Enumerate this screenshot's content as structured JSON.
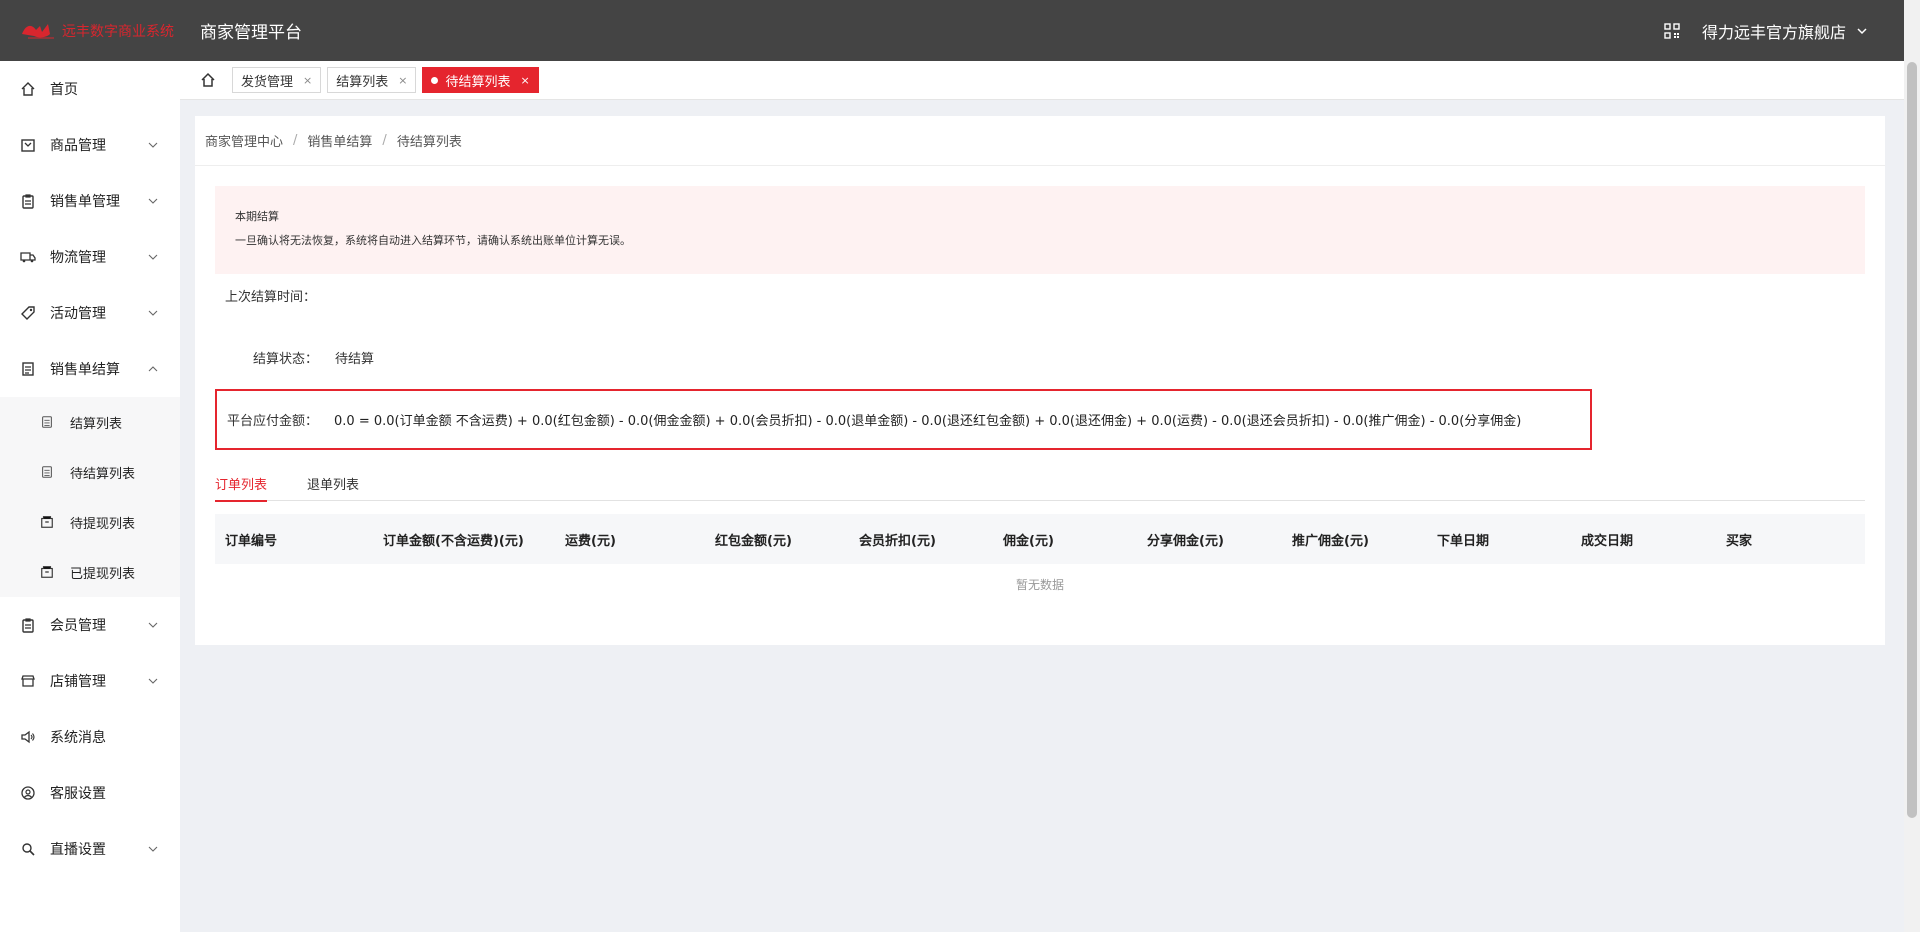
{
  "header": {
    "logo_text": "远丰数字商业系统",
    "app_title": "商家管理平台",
    "shop_name": "得力远丰官方旗舰店"
  },
  "sidebar": {
    "items": [
      {
        "label": "首页",
        "icon": "home-icon",
        "has_chevron": false
      },
      {
        "label": "商品管理",
        "icon": "goods-icon",
        "has_chevron": true
      },
      {
        "label": "销售单管理",
        "icon": "clipboard-icon",
        "has_chevron": true
      },
      {
        "label": "物流管理",
        "icon": "truck-icon",
        "has_chevron": true
      },
      {
        "label": "活动管理",
        "icon": "tag-icon",
        "has_chevron": true
      },
      {
        "label": "销售单结算",
        "icon": "document-icon",
        "has_chevron": true,
        "expanded": true
      }
    ],
    "submenu": [
      {
        "label": "结算列表",
        "icon": "list-icon"
      },
      {
        "label": "待结算列表",
        "icon": "list-icon"
      },
      {
        "label": "待提现列表",
        "icon": "wallet-icon"
      },
      {
        "label": "已提现列表",
        "icon": "wallet-icon"
      }
    ],
    "items_after": [
      {
        "label": "会员管理",
        "icon": "member-icon",
        "has_chevron": true
      },
      {
        "label": "店铺管理",
        "icon": "store-icon",
        "has_chevron": true
      },
      {
        "label": "系统消息",
        "icon": "speaker-icon",
        "has_chevron": false
      },
      {
        "label": "客服设置",
        "icon": "service-icon",
        "has_chevron": false
      },
      {
        "label": "直播设置",
        "icon": "live-icon",
        "has_chevron": true
      }
    ]
  },
  "tabs": [
    {
      "label": "发货管理",
      "active": false
    },
    {
      "label": "结算列表",
      "active": false
    },
    {
      "label": "待结算列表",
      "active": true
    }
  ],
  "breadcrumb": [
    "商家管理中心",
    "销售单结算",
    "待结算列表"
  ],
  "notice": {
    "title": "本期结算",
    "body": "一旦确认将无法恢复，系统将自动进入结算环节，请确认系统出账单位计算无误。"
  },
  "fields": {
    "last_time_label": "上次结算时间：",
    "status_label": "结算状态：",
    "status_value": "待结算",
    "amount_label": "平台应付金额：",
    "amount_formula": "0.0 = 0.0(订单金额 不含运费) + 0.0(红包金额) - 0.0(佣金金额) + 0.0(会员折扣) - 0.0(退单金额) - 0.0(退还红包金额) + 0.0(退还佣金) + 0.0(运费) - 0.0(退还会员折扣) - 0.0(推广佣金) - 0.0(分享佣金)"
  },
  "subtabs": [
    {
      "label": "订单列表",
      "active": true
    },
    {
      "label": "退单列表",
      "active": false
    }
  ],
  "table": {
    "columns": [
      "订单编号",
      "订单金额(不含运费)(元)",
      "运费(元)",
      "红包金额(元)",
      "会员折扣(元)",
      "佣金(元)",
      "分享佣金(元)",
      "推广佣金(元)",
      "下单日期",
      "成交日期",
      "买家"
    ],
    "empty_text": "暂无数据"
  },
  "colors": {
    "accent": "#e5252e",
    "header_bg": "#444444"
  }
}
